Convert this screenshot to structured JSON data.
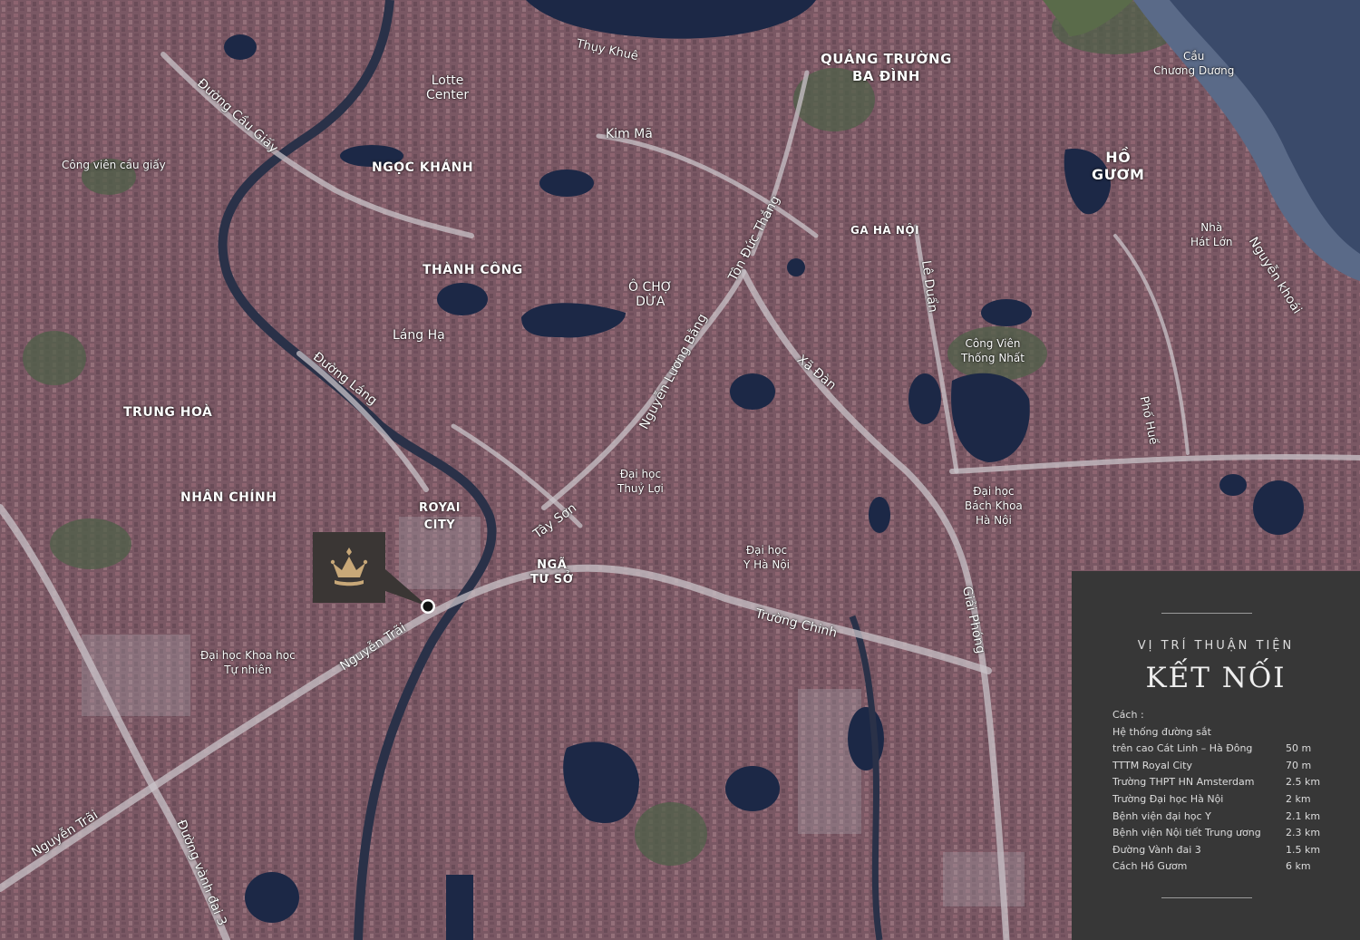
{
  "labels": {
    "thuy_khue": "Thụy Khuê",
    "quang_truong_1": "QUẢNG TRƯỜNG",
    "quang_truong_2": "BA ĐÌNH",
    "cau_1": "Cầu",
    "cau_2": "Chương Dương",
    "lotte_1": "Lotte",
    "lotte_2": "Center",
    "duong_cau_giay": "Đường Cầu Giấy",
    "kim_ma": "Kim Mã",
    "ho_guom_1": "HỒ",
    "ho_guom_2": "GƯƠM",
    "cong_vien_cau_giay": "Công viên cầu giấy",
    "ngoc_khanh": "NGỌC KHÁNH",
    "ton_duc_thang": "Tôn Đức Thắng",
    "ga_ha_noi": "GA HÀ NỘI",
    "nha_hat_lon_1": "Nhà",
    "nha_hat_lon_2": "Hát Lớn",
    "nguyen_khoai": "Nguyễn khoái",
    "thanh_cong": "THÀNH CÔNG",
    "o_cho_dua_1": "Ô CHỢ",
    "o_cho_dua_2": "DỪA",
    "le_duan": "Lê Duẩn",
    "lang_ha": "Láng Hạ",
    "nguyen_luong_bang": "Nguyễn Lương Bằng",
    "cong_vien_thong_nhat_1": "Công Viên",
    "cong_vien_thong_nhat_2": "Thống Nhất",
    "duong_lang": "Đường Láng",
    "xa_dan": "Xã Đàn",
    "pho_hue": "Phố Huế",
    "trung_hoa": "TRUNG HOÀ",
    "dh_thuy_loi_1": "Đại học",
    "dh_thuy_loi_2": "Thuỷ Lợi",
    "dh_bach_khoa_1": "Đại học",
    "dh_bach_khoa_2": "Bách Khoa",
    "dh_bach_khoa_3": "Hà Nội",
    "nhan_chinh": "NHÂN CHÍNH",
    "royal_city_1": "ROYAl",
    "royal_city_2": "CITY",
    "tay_son": "Tây Sơn",
    "dh_y_1": "Đại học",
    "dh_y_2": "Y Hà Nội",
    "nga_tu_so_1": "NGÃ",
    "nga_tu_so_2": "TƯ SỞ",
    "giai_phong": "Giải Phóng",
    "truong_chinh": "Trường Chinh",
    "dh_khtn_1": "Đại học Khoa học",
    "dh_khtn_2": "Tự nhiên",
    "nguyen_trai_1": "Nguyễn Trãi",
    "nguyen_trai_2": "Nguyễn Trãi",
    "duong_vanh_dai_3": "Đường vành đai 3"
  },
  "marker": {
    "icon": "crown-icon",
    "color": "#c8a878"
  },
  "panel": {
    "subtitle": "VỊ TRÍ THUẬN TIỆN",
    "title": "KẾT NỐI",
    "intro": "Cách :",
    "items": [
      {
        "label": "Hệ thống đường sắt",
        "value": ""
      },
      {
        "label": "trên cao Cát Linh – Hà Đông",
        "value": "50 m"
      },
      {
        "label": "TTTM Royal City",
        "value": "70 m"
      },
      {
        "label": "Trường THPT HN Amsterdam",
        "value": "2.5 km"
      },
      {
        "label": "Trường Đại học Hà Nội",
        "value": "2 km"
      },
      {
        "label": "Bệnh viện đại học Y",
        "value": "2.1 km"
      },
      {
        "label": "Bệnh viện Nội tiết Trung ương",
        "value": "2.3 km"
      },
      {
        "label": "Đường Vành đai 3",
        "value": "1.5 km"
      },
      {
        "label": "Cách Hồ Gươm",
        "value": "6 km"
      }
    ]
  },
  "colors": {
    "panel_bg": "#373737",
    "city": "#7d5a66",
    "water": "#1e2a45",
    "road": "#c8c4c8"
  }
}
